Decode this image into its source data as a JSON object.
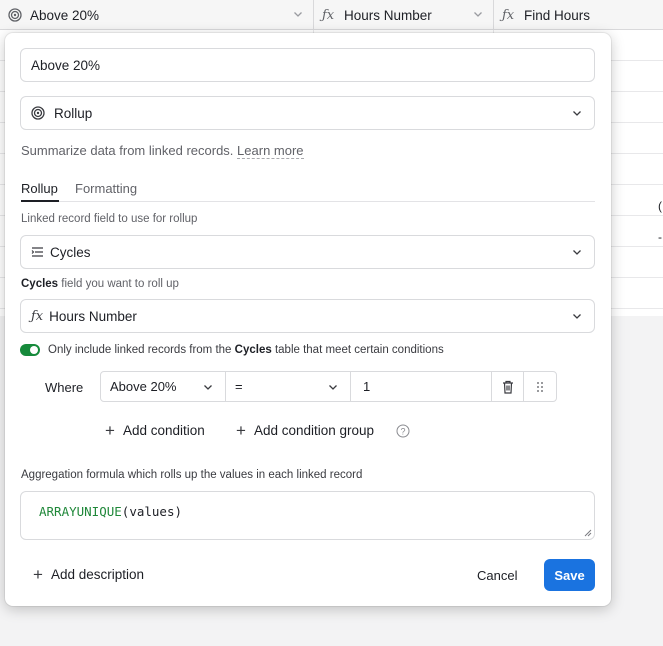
{
  "grid": {
    "columns": [
      {
        "icon": "rollup-icon",
        "label": "Above 20%"
      },
      {
        "icon": "formula-icon",
        "label": "Hours Number"
      },
      {
        "icon": "formula-icon",
        "label": "Find Hours"
      }
    ],
    "edge_values": [
      "(",
      "-"
    ]
  },
  "dialog": {
    "field_name": "Above 20%",
    "field_type": {
      "icon": "rollup-icon",
      "label": "Rollup"
    },
    "description": "Summarize data from linked records.",
    "learn_more": "Learn more",
    "tabs": [
      {
        "label": "Rollup",
        "active": true
      },
      {
        "label": "Formatting",
        "active": false
      }
    ],
    "linked_field_label": "Linked record field to use for rollup",
    "linked_field": {
      "icon": "linked-records-icon",
      "label": "Cycles"
    },
    "rollup_field_label_bold": "Cycles",
    "rollup_field_label_rest": "field you want to roll up",
    "rollup_field": {
      "icon": "formula-icon",
      "label": "Hours Number"
    },
    "filter_toggle": {
      "on": true,
      "text_before": "Only include linked records from the",
      "table": "Cycles",
      "text_after": "table that meet certain conditions"
    },
    "condition": {
      "where_label": "Where",
      "field": "Above 20%",
      "operator": "=",
      "value": "1"
    },
    "add_condition": "Add condition",
    "add_condition_group": "Add condition group",
    "aggregation_label": "Aggregation formula which rolls up the values in each linked record",
    "formula": {
      "function": "ARRAYUNIQUE",
      "args": "(values)"
    },
    "add_description": "Add description",
    "cancel_label": "Cancel",
    "save_label": "Save",
    "accent": "#1a73e0",
    "toggle_color": "#168a3b"
  }
}
